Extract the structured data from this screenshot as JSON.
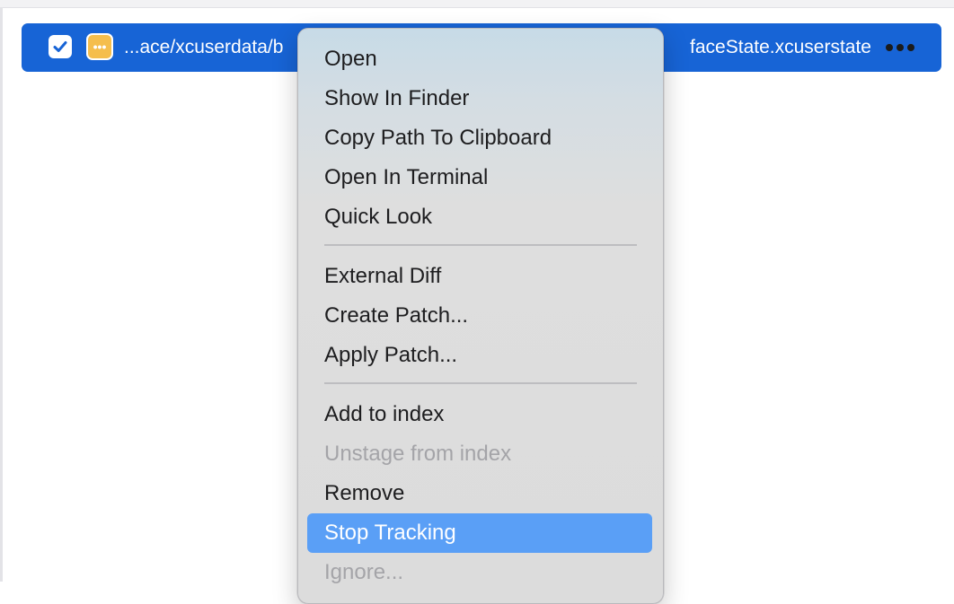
{
  "file_row": {
    "path_start": "...ace/xcuserdata/b",
    "path_end": "faceState.xcuserstate",
    "checkbox_mark": "✓",
    "status_icon_glyph": "•••",
    "selected_color": "#1764d6",
    "status_color": "#f5be4d"
  },
  "context_menu": {
    "highlight_color": "#5a9ff6",
    "items": [
      {
        "label": "Open"
      },
      {
        "label": "Show In Finder"
      },
      {
        "label": "Copy Path To Clipboard"
      },
      {
        "label": "Open In Terminal"
      },
      {
        "label": "Quick Look"
      },
      {
        "label": "External Diff"
      },
      {
        "label": "Create Patch..."
      },
      {
        "label": "Apply Patch..."
      },
      {
        "label": "Add to index"
      },
      {
        "label": "Unstage from index",
        "disabled": true
      },
      {
        "label": "Remove"
      },
      {
        "label": "Stop Tracking",
        "highlighted": true
      },
      {
        "label": "Ignore...",
        "disabled": true
      }
    ]
  }
}
